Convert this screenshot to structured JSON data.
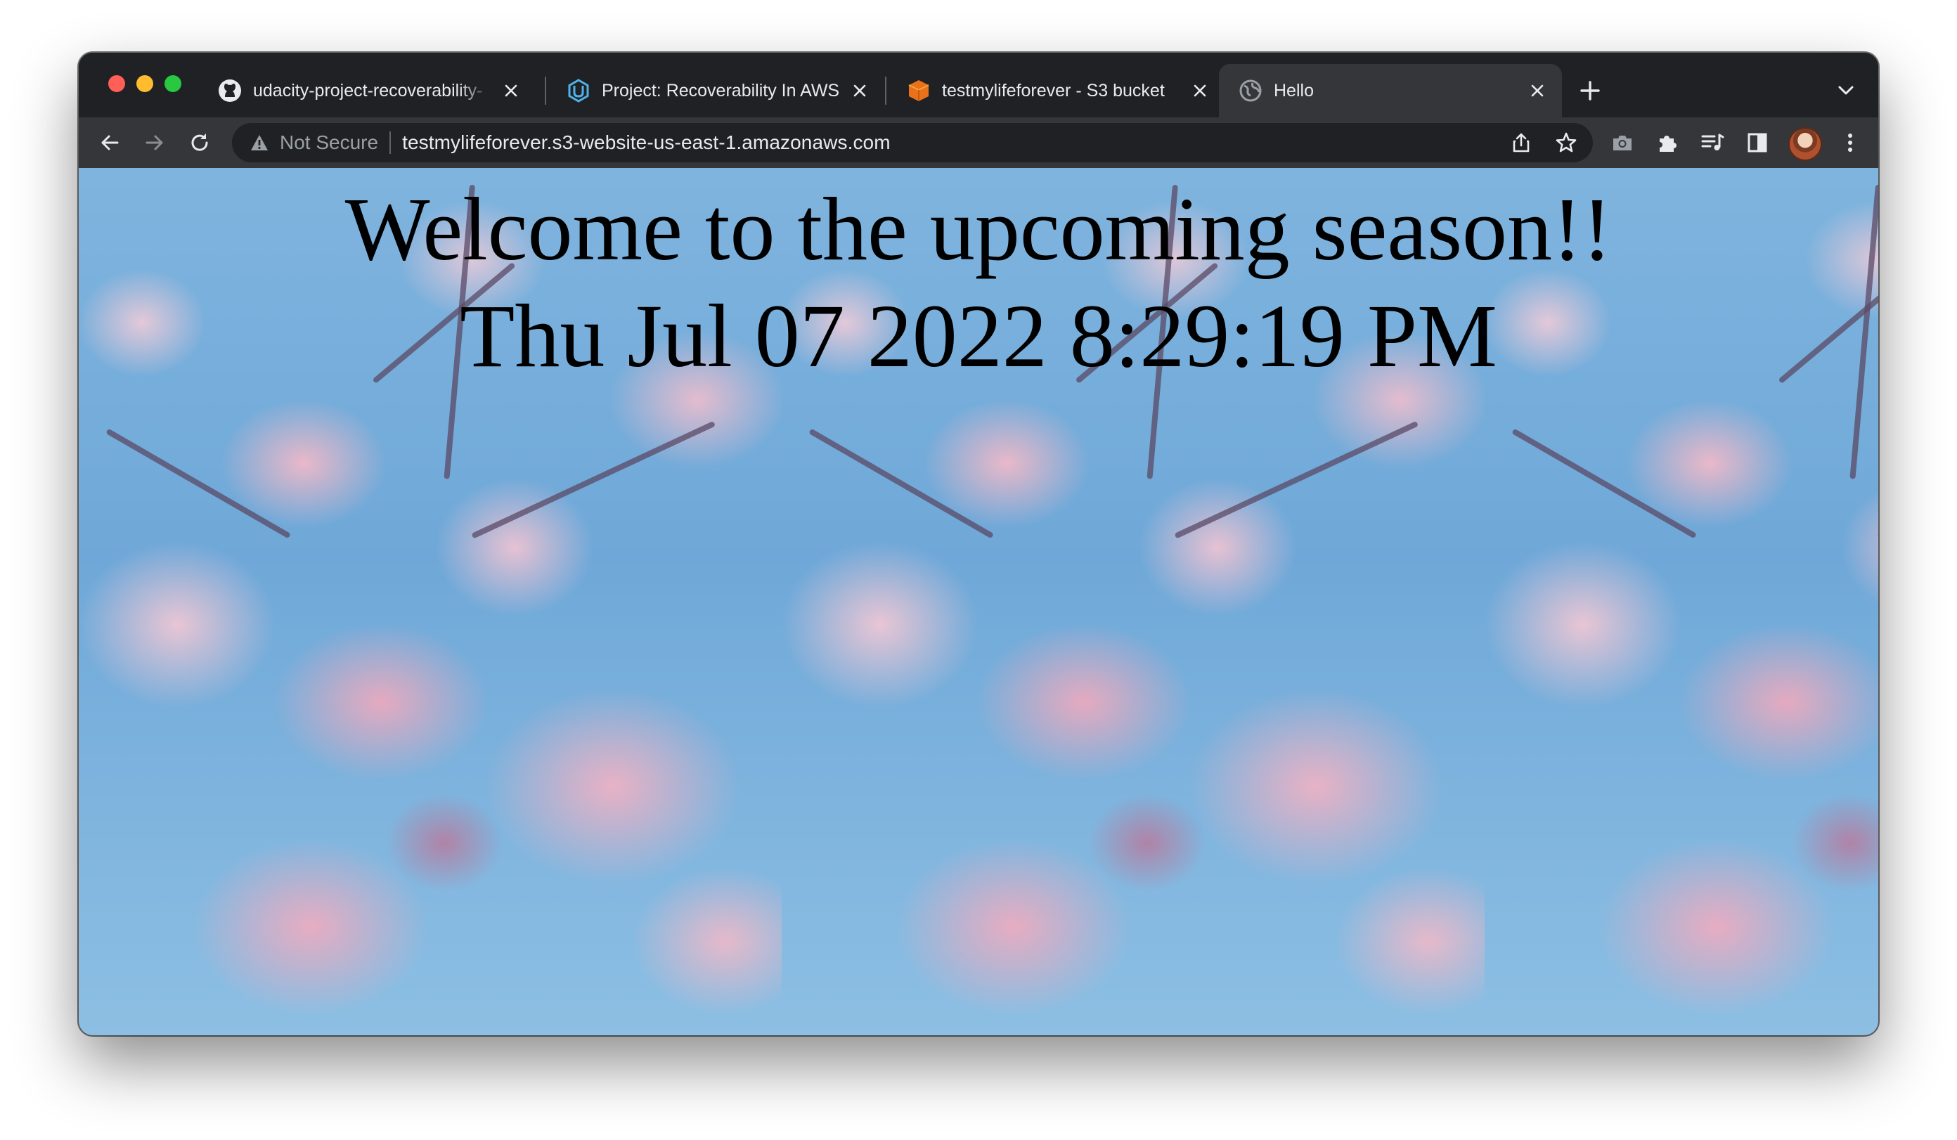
{
  "browser": {
    "tabs": [
      {
        "title": "udacity-project-recoverability-",
        "favicon": "github-icon",
        "active": false
      },
      {
        "title": "Project: Recoverability In AWS",
        "favicon": "udacity-icon",
        "active": false
      },
      {
        "title": "testmylifeforever - S3 bucket",
        "favicon": "aws-s3-icon",
        "active": false
      },
      {
        "title": "Hello",
        "favicon": "globe-icon",
        "active": true
      }
    ],
    "address_bar": {
      "security_label": "Not Secure",
      "url": "testmylifeforever.s3-website-us-east-1.amazonaws.com"
    },
    "colors": {
      "tabstrip": "#202124",
      "toolbar": "#35363a",
      "omnibox": "#202124"
    }
  },
  "page": {
    "heading": "Welcome to the upcoming season!!",
    "datetime": "Thu Jul 07 2022 8:29:19 PM",
    "background": "cherry-blossom-image"
  }
}
